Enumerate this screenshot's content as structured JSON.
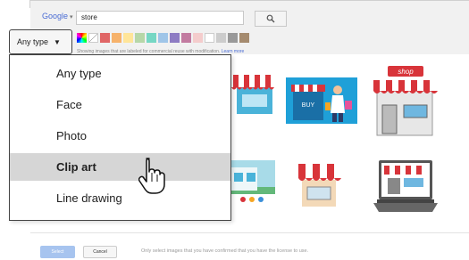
{
  "search": {
    "logo_label": "Google",
    "query": "store",
    "search_icon": "magnifier-icon"
  },
  "filters": {
    "color_swatches": [
      "full-color",
      "transparent",
      "#e06666",
      "#f6b26b",
      "#ffe599",
      "#b6d7a8",
      "#76d7c4",
      "#9fc5e8",
      "#8e7cc3",
      "#c27ba0",
      "#f4cccc",
      "#ffffff",
      "#cccccc",
      "#999999",
      "#a58b6f"
    ],
    "license_text": "Showing images that are labeled for commercial reuse with modification.",
    "license_link": "Learn more"
  },
  "type_button": {
    "label": "Any type"
  },
  "type_dropdown": {
    "items": [
      {
        "label": "Any type"
      },
      {
        "label": "Face"
      },
      {
        "label": "Photo"
      },
      {
        "label": "Clip art",
        "selected": true
      },
      {
        "label": "Line drawing"
      }
    ]
  },
  "thumbnails": [
    {
      "name": "awning-store-1"
    },
    {
      "name": "buy-shopping-woman"
    },
    {
      "name": "shop-sign-storefront",
      "sign_text": "shop"
    },
    {
      "name": "store-illustration"
    },
    {
      "name": "red-awning-store"
    },
    {
      "name": "laptop-online-store"
    }
  ],
  "thumb_text": {
    "buy_label": "BUY"
  },
  "footer": {
    "select_label": "Select",
    "cancel_label": "Cancel",
    "note": "Only select images that you have confirmed that you have the license to use."
  }
}
